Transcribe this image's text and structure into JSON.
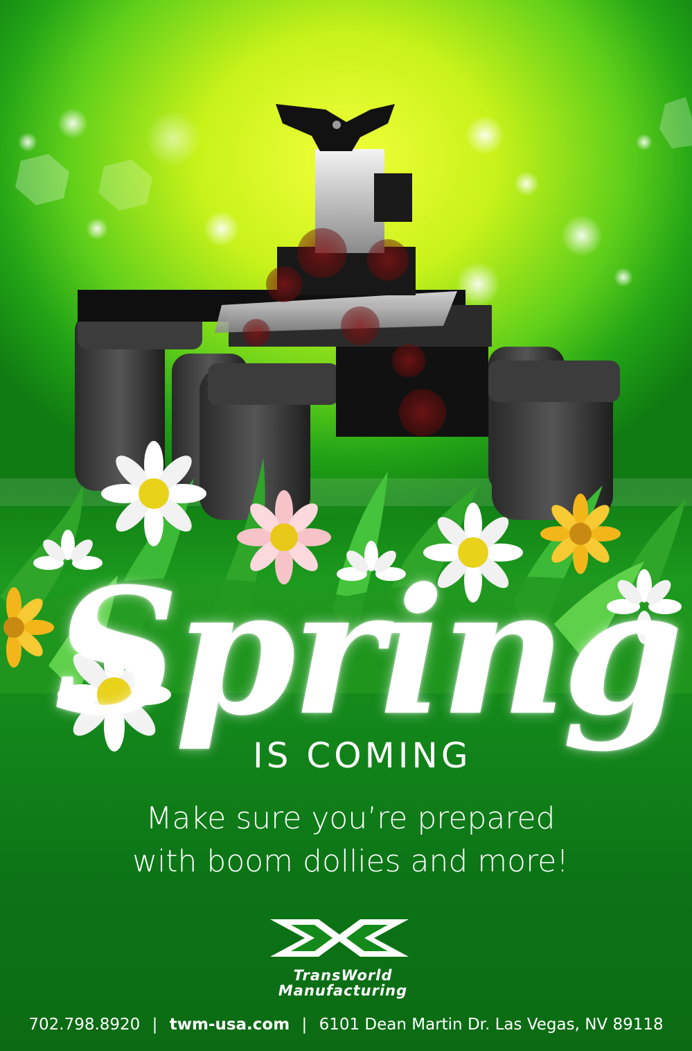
{
  "headline": {
    "script_word": "Spring",
    "subhead": "IS COMING"
  },
  "tagline": {
    "line1": "Make sure you’re prepared",
    "line2": "with boom dollies and more!"
  },
  "brand": {
    "line1": "TransWorld",
    "line2": "Manufacturing"
  },
  "footer": {
    "phone": "702.798.8920",
    "separator": "|",
    "website": "twm-usa.com",
    "address": "6101 Dean Martin Dr. Las Vegas, NV 89118"
  },
  "colors": {
    "bright_lime": "#f2ff3a",
    "green": "#1c9a1e",
    "dark_green": "#0b6b14",
    "text": "#ffffff"
  },
  "icons": {
    "logo": "twm-x-logo",
    "product": "boom-dolly-illustration",
    "flowers": "daisy-icon"
  }
}
